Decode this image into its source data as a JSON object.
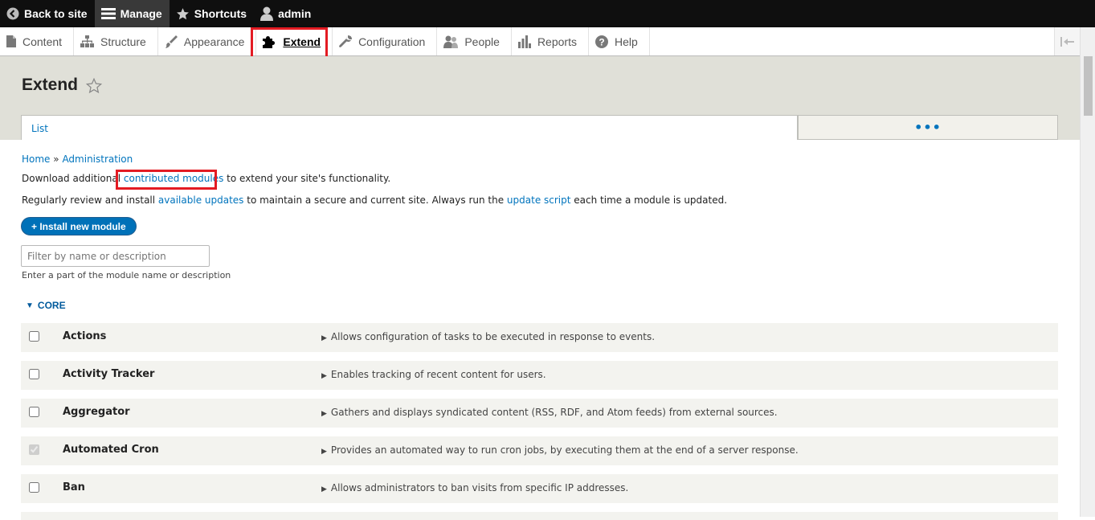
{
  "toolbar": {
    "back_label": "Back to site",
    "manage_label": "Manage",
    "shortcuts_label": "Shortcuts",
    "user_label": "admin"
  },
  "tray": {
    "items": [
      {
        "label": "Content",
        "icon": "page-icon"
      },
      {
        "label": "Structure",
        "icon": "sitemap-icon"
      },
      {
        "label": "Appearance",
        "icon": "paintbrush-icon"
      },
      {
        "label": "Extend",
        "icon": "puzzle-icon"
      },
      {
        "label": "Configuration",
        "icon": "wrench-icon"
      },
      {
        "label": "People",
        "icon": "people-icon"
      },
      {
        "label": "Reports",
        "icon": "bar-chart-icon"
      },
      {
        "label": "Help",
        "icon": "help-icon"
      }
    ]
  },
  "page": {
    "title": "Extend",
    "tabs": {
      "list": "List",
      "more": "•••"
    }
  },
  "breadcrumb": {
    "home": "Home",
    "sep": "»",
    "admin": "Administration"
  },
  "intro": {
    "p1_before": "Download additional ",
    "p1_link": "contributed modules",
    "p1_after": " to extend your site's functionality.",
    "p2_before": "Regularly review and install ",
    "p2_link1": "available updates",
    "p2_middle": " to maintain a secure and current site. Always run the ",
    "p2_link2": "update script",
    "p2_after": " each time a module is updated."
  },
  "install_button": "+ Install new module",
  "filter": {
    "placeholder": "Filter by name or description",
    "description": "Enter a part of the module name or description"
  },
  "core_label": "CORE",
  "modules": [
    {
      "name": "Actions",
      "desc": "Allows configuration of tasks to be executed in response to events.",
      "checked": false,
      "disabled": false
    },
    {
      "name": "Activity Tracker",
      "desc": "Enables tracking of recent content for users.",
      "checked": false,
      "disabled": false
    },
    {
      "name": "Aggregator",
      "desc": "Gathers and displays syndicated content (RSS, RDF, and Atom feeds) from external sources.",
      "checked": false,
      "disabled": false
    },
    {
      "name": "Automated Cron",
      "desc": "Provides an automated way to run cron jobs, by executing them at the end of a server response.",
      "checked": true,
      "disabled": true
    },
    {
      "name": "Ban",
      "desc": "Allows administrators to ban visits from specific IP addresses.",
      "checked": false,
      "disabled": false
    }
  ],
  "colors": {
    "link": "#0074bd",
    "highlight": "#e31b23",
    "toolbar": "#0f0f0f",
    "button": "#0071b8"
  }
}
